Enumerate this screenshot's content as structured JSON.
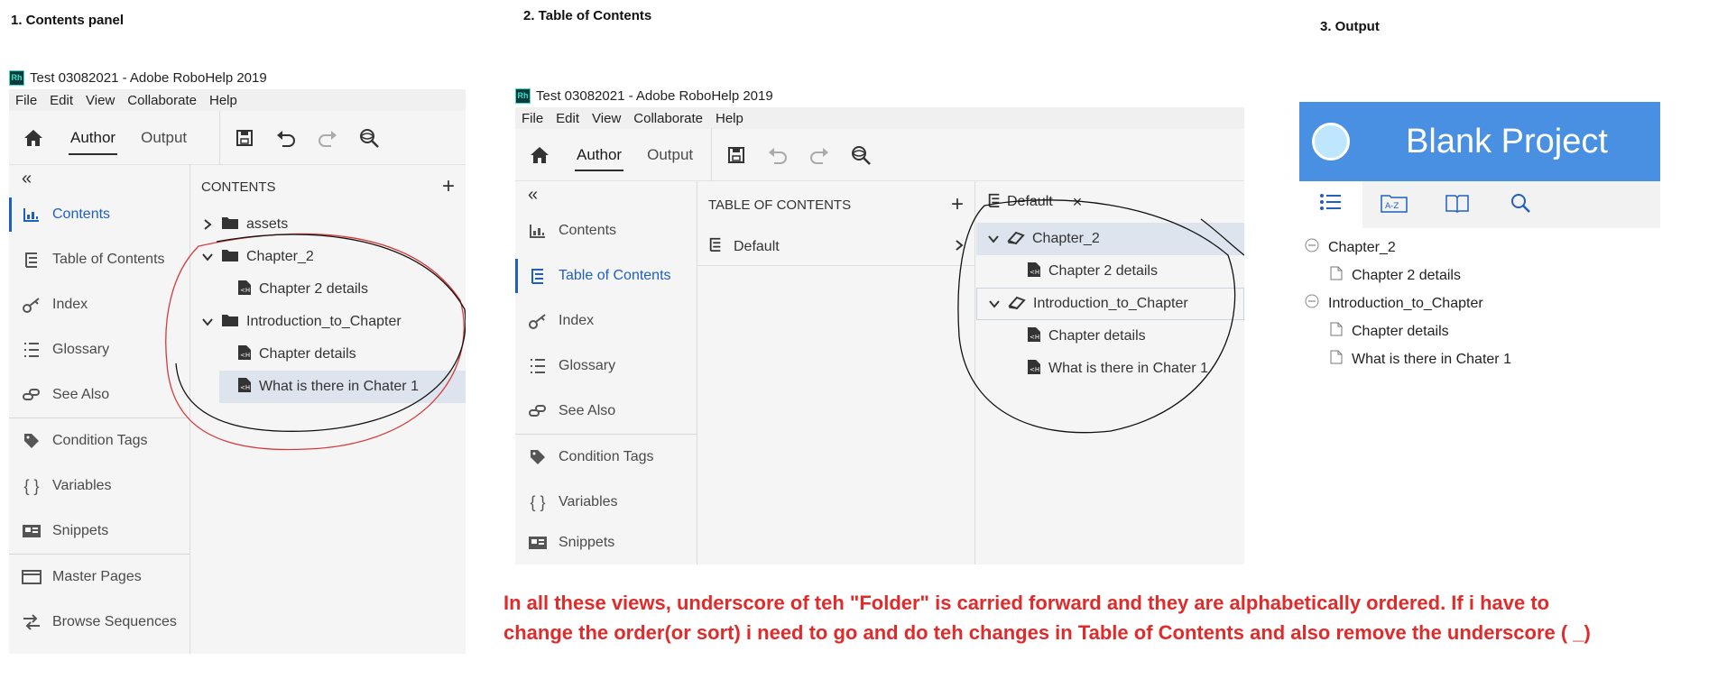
{
  "captions": {
    "c1": "1. Contents panel",
    "c2": "2. Table of Contents",
    "c3": "3. Output"
  },
  "app": {
    "title": "Test 03082021 - Adobe RoboHelp 2019",
    "logo_text": "Rh",
    "menu": [
      "File",
      "Edit",
      "View",
      "Collaborate",
      "Help"
    ],
    "tabs": [
      "Author",
      "Output"
    ],
    "collapse_glyph": "«"
  },
  "nav": {
    "items": [
      {
        "label": "Contents",
        "icon": "contents-icon"
      },
      {
        "label": "Table of Contents",
        "icon": "toc-icon"
      },
      {
        "label": "Index",
        "icon": "key-icon"
      },
      {
        "label": "Glossary",
        "icon": "glossary-icon"
      },
      {
        "label": "See Also",
        "icon": "link-icon"
      },
      {
        "label": "Condition Tags",
        "icon": "tag-icon"
      },
      {
        "label": "Variables",
        "icon": "braces-icon"
      },
      {
        "label": "Snippets",
        "icon": "snippet-icon"
      },
      {
        "label": "Master Pages",
        "icon": "master-page-icon"
      },
      {
        "label": "Browse Sequences",
        "icon": "sequence-icon"
      }
    ]
  },
  "contents_panel": {
    "header": "CONTENTS",
    "tree": [
      {
        "label": "assets",
        "type": "folder",
        "state": "collapsed"
      },
      {
        "label": "Chapter_2",
        "type": "folder",
        "state": "expanded"
      },
      {
        "label": "Chapter 2 details",
        "type": "topic"
      },
      {
        "label": "Introduction_to_Chapter",
        "type": "folder",
        "state": "expanded"
      },
      {
        "label": "Chapter details",
        "type": "topic"
      },
      {
        "label": "What is there in Chater 1",
        "type": "topic",
        "selected": true
      }
    ]
  },
  "toc_panel": {
    "header": "TABLE OF CONTENTS",
    "toc_item": "Default",
    "editor_tab": "Default",
    "close_glyph": "×",
    "tree": [
      {
        "label": "Chapter_2",
        "type": "book"
      },
      {
        "label": "Chapter 2 details",
        "type": "topic"
      },
      {
        "label": "Introduction_to_Chapter",
        "type": "book"
      },
      {
        "label": "Chapter details",
        "type": "topic"
      },
      {
        "label": "What is there in Chater 1",
        "type": "topic"
      }
    ]
  },
  "output": {
    "title": "Blank Project",
    "tab_icons": [
      "list-icon",
      "az-index-icon",
      "book-icon",
      "search-icon"
    ],
    "tree": [
      {
        "label": "Chapter_2",
        "type": "book"
      },
      {
        "label": "Chapter 2 details",
        "type": "page"
      },
      {
        "label": "Introduction_to_Chapter",
        "type": "book"
      },
      {
        "label": "Chapter details",
        "type": "page"
      },
      {
        "label": "What is there in Chater 1",
        "type": "page"
      }
    ]
  },
  "note": {
    "line1": "In all these views, underscore of teh \"Folder\" is carried forward and they are alphabetically ordered. If i have to",
    "line2": "change the order(or sort) i need to go and do teh changes in Table of Contents and also remove the underscore ( _)"
  },
  "colors": {
    "accent_blue": "#1f5fc1",
    "output_header": "#4a90e2",
    "note_red": "#e02b2b"
  }
}
